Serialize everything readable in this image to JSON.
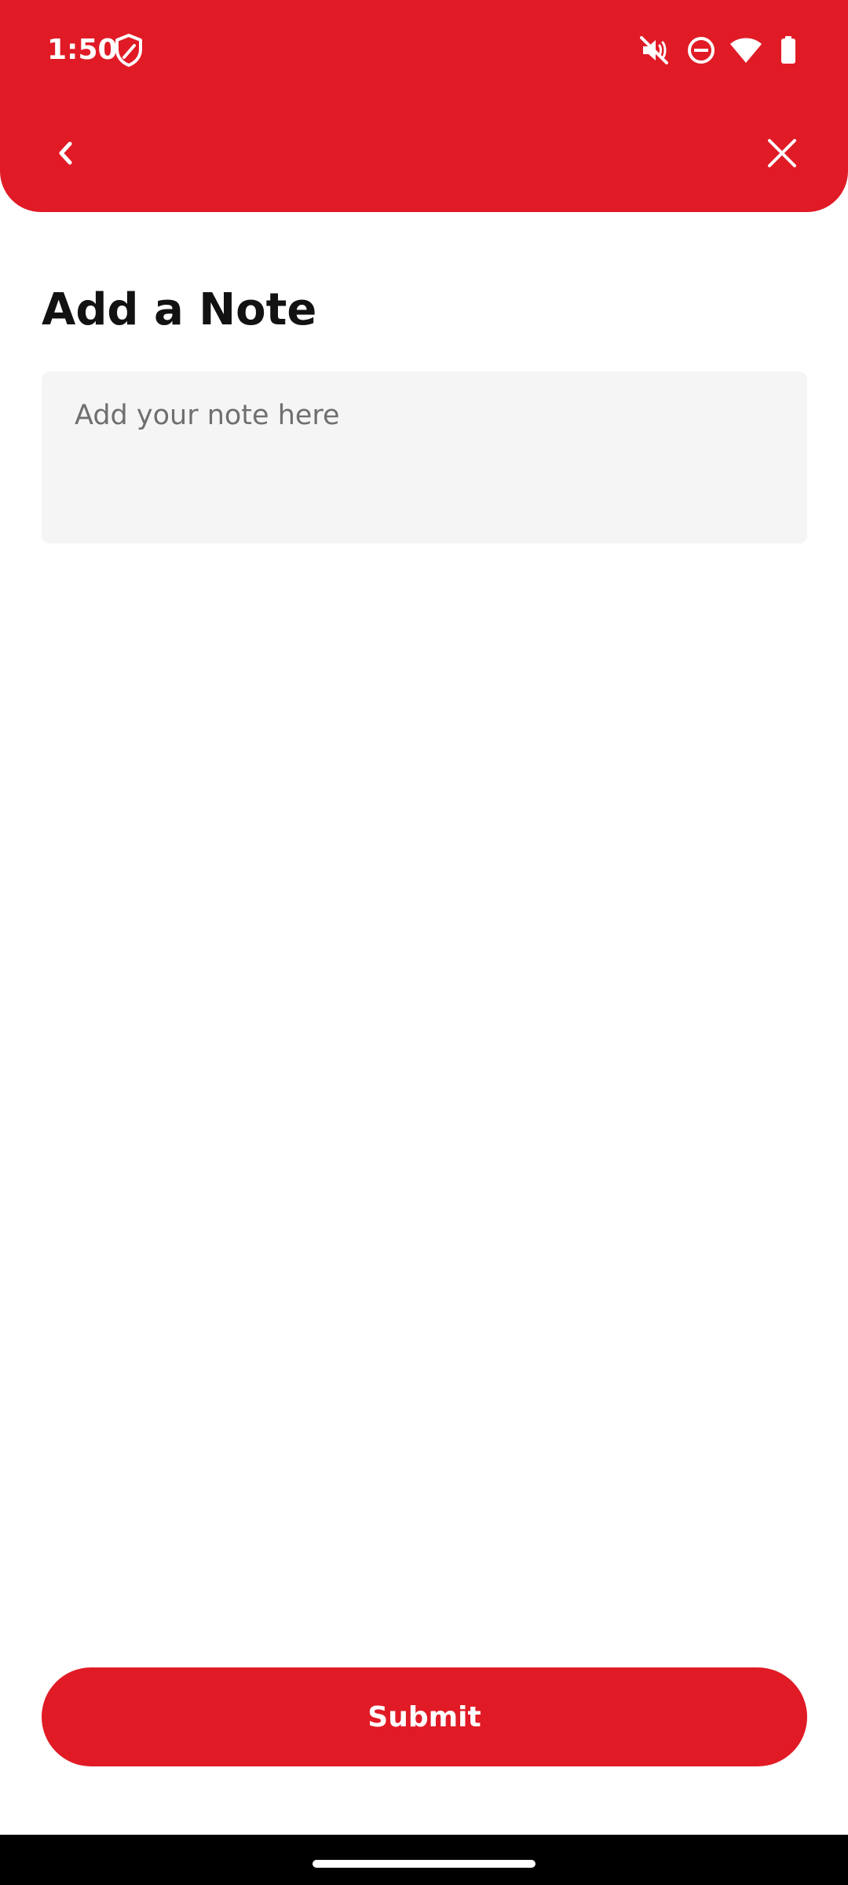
{
  "status_bar": {
    "time": "1:50",
    "icons": [
      "shield-icon",
      "mute-icon",
      "do-not-disturb-icon",
      "wifi-icon",
      "battery-icon"
    ]
  },
  "header": {
    "back_icon": "chevron-left-icon",
    "close_icon": "close-icon",
    "color": "#e01b26"
  },
  "main": {
    "title": "Add a Note",
    "note_input": {
      "placeholder": "Add your note here",
      "value": ""
    }
  },
  "footer": {
    "submit_label": "Submit"
  }
}
